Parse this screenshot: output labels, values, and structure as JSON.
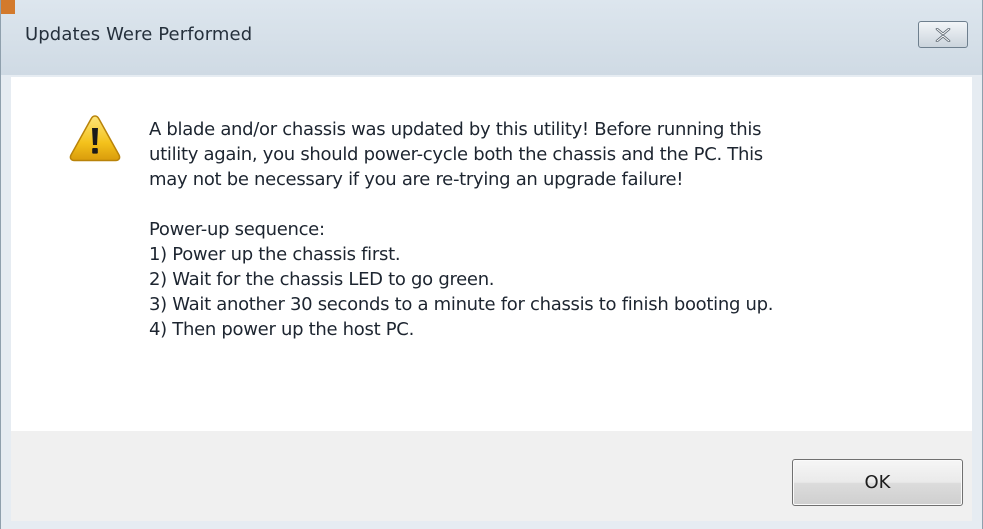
{
  "window": {
    "title": "Updates Were Performed",
    "close_icon": "close-icon"
  },
  "dialog": {
    "icon": "warning-icon",
    "message_lines": [
      "A blade and/or chassis was updated by this utility!  Before running this",
      "utility again, you should power-cycle both the chassis and the PC.  This",
      "may not be necessary if you are re-trying an upgrade failure!"
    ],
    "sequence_heading": "Power-up sequence:",
    "steps": [
      "1) Power up the chassis first.",
      "2) Wait for the chassis LED to go green.",
      "3) Wait another 30 seconds to a minute for chassis to finish booting up.",
      "4) Then power up the host PC."
    ]
  },
  "buttons": {
    "ok_label": "OK"
  },
  "colors": {
    "titlebar": "#d3dde7",
    "accent": "#d37a2c",
    "warning_yellow": "#f3c21d"
  }
}
